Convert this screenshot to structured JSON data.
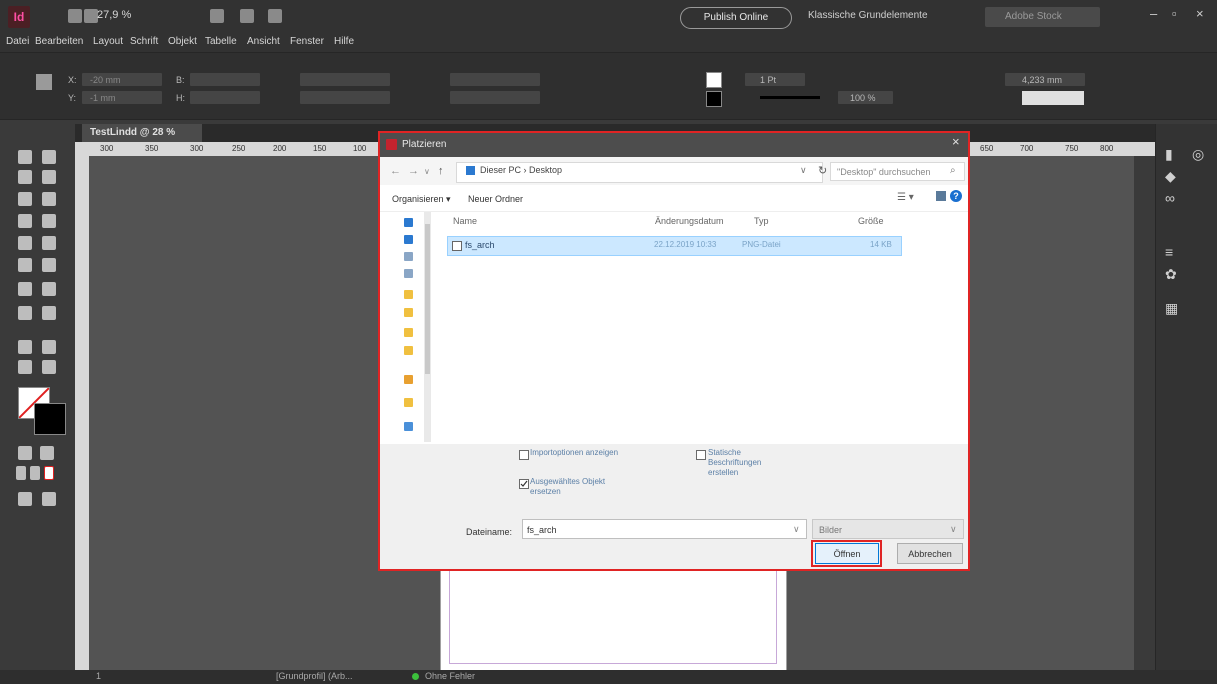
{
  "app": {
    "zoom": "27,9 %",
    "publish_label": "Publish Online",
    "workspace": "Klassische Grundelemente",
    "search_placeholder": "Adobe Stock"
  },
  "menu": [
    "Datei",
    "Bearbeiten",
    "Layout",
    "Schrift",
    "Objekt",
    "Tabelle",
    "Ansicht",
    "Fenster",
    "Hilfe"
  ],
  "control": {
    "x_label": "X:",
    "x_value": "-20 mm",
    "y_label": "Y:",
    "y_value": "-1 mm",
    "w_label": "B:",
    "h_label": "H:",
    "stroke_value": "1 Pt",
    "opacity_value": "100 %",
    "width_value": "4,233 mm"
  },
  "document": {
    "tab_label": "TestLindd @ 28 %",
    "ruler_ticks": [
      "300",
      "350",
      "300",
      "250",
      "200",
      "150",
      "100"
    ],
    "ruler_ticks_right": [
      "650",
      "700",
      "750",
      "800"
    ]
  },
  "status": {
    "page": "1",
    "profile": "[Grundprofil] (Arb...",
    "errors": "Ohne Fehler"
  },
  "dialog": {
    "title": "Platzieren",
    "address": "Dieser PC  ›  Desktop",
    "search_placeholder": "\"Desktop\" durchsuchen",
    "organize": "Organisieren ▾",
    "new_folder": "Neuer Ordner",
    "columns": {
      "name": "Name",
      "date": "Änderungsdatum",
      "type": "Typ",
      "size": "Größe"
    },
    "files": [
      {
        "name": "fs_arch",
        "date": "22.12.2019 10:33",
        "type": "PNG-Datei",
        "size": "14 KB"
      }
    ],
    "options": {
      "import_options": "Importoptionen anzeigen",
      "replace_selected": "Ausgewähltes Objekt ersetzen",
      "create_captions": "Statische Beschriftungen erstellen"
    },
    "filename_label": "Dateiname:",
    "filename_value": "fs_arch",
    "filter": "Bilder",
    "open_label": "Öffnen",
    "cancel_label": "Abbrechen"
  }
}
